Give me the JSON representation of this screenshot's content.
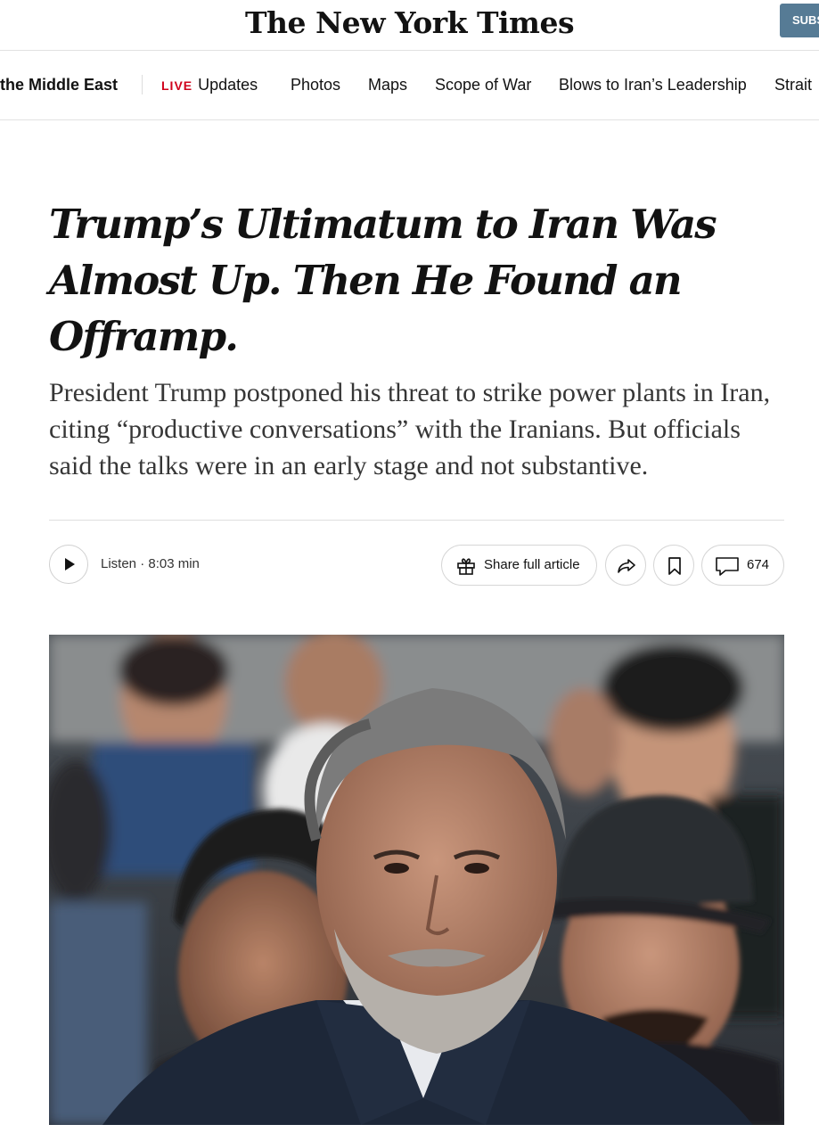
{
  "masthead": {
    "logo": "The New York Times",
    "subscribe_label": "SUBSCRIBE"
  },
  "nav": {
    "section": "the Middle East",
    "live_tag": "LIVE",
    "items": [
      "Updates",
      "Photos",
      "Maps",
      "Scope of War",
      "Blows to Iran’s Leadership",
      "Strait"
    ]
  },
  "article": {
    "headline": "Trump’s Ultimatum to Iran Was Almost Up. Then He Found an Offramp.",
    "summary": "President Trump postponed his threat to strike power plants in Iran, citing “productive conversations” with the Iranians. But officials said the talks were in an early stage and not substantive."
  },
  "tools": {
    "listen_label": "Listen · 8:03 min",
    "share_full_label": "Share full article",
    "comment_count": "674"
  },
  "icons": {
    "play": "play-icon",
    "gift": "gift-icon",
    "share": "share-arrow-icon",
    "bookmark": "bookmark-icon",
    "comment": "comment-bubble-icon"
  },
  "colors": {
    "live_red": "#d0021b",
    "subscribe_blue": "#567b95"
  }
}
